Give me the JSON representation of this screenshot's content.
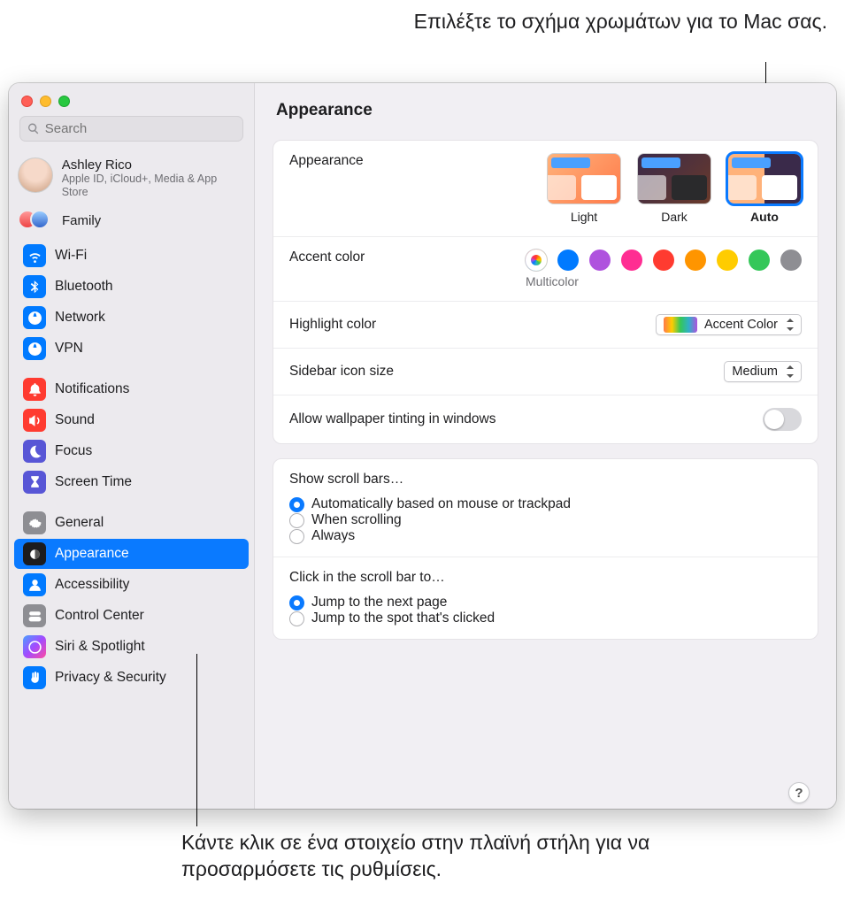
{
  "callouts": {
    "top": "Επιλέξτε το σχήμα χρωμάτων για το Mac σας.",
    "bottom": "Κάντε κλικ σε ένα στοιχείο στην πλαϊνή στήλη για να προσαρμόσετε τις ρυθμίσεις."
  },
  "window": {
    "title": "Appearance",
    "search_placeholder": "Search",
    "account": {
      "name": "Ashley Rico",
      "sub": "Apple ID, iCloud+, Media & App Store"
    },
    "family_label": "Family",
    "sidebar_groups": [
      {
        "items": [
          {
            "label": "Wi-Fi",
            "icon": "wifi",
            "cls": "ic-blue"
          },
          {
            "label": "Bluetooth",
            "icon": "bluetooth",
            "cls": "ic-blue"
          },
          {
            "label": "Network",
            "icon": "globe",
            "cls": "ic-blue"
          },
          {
            "label": "VPN",
            "icon": "globe",
            "cls": "ic-blue"
          }
        ]
      },
      {
        "items": [
          {
            "label": "Notifications",
            "icon": "bell",
            "cls": "ic-red"
          },
          {
            "label": "Sound",
            "icon": "speaker",
            "cls": "ic-red"
          },
          {
            "label": "Focus",
            "icon": "moon",
            "cls": "ic-purple"
          },
          {
            "label": "Screen Time",
            "icon": "hourglass",
            "cls": "ic-purple"
          }
        ]
      },
      {
        "items": [
          {
            "label": "General",
            "icon": "gear",
            "cls": "ic-gray"
          },
          {
            "label": "Appearance",
            "icon": "appearance",
            "cls": "ic-black",
            "selected": true
          },
          {
            "label": "Accessibility",
            "icon": "person",
            "cls": "ic-blue"
          },
          {
            "label": "Control Center",
            "icon": "switches",
            "cls": "ic-gray"
          },
          {
            "label": "Siri & Spotlight",
            "icon": "siri",
            "cls": "ic-multi"
          },
          {
            "label": "Privacy & Security",
            "icon": "hand",
            "cls": "ic-blue"
          }
        ]
      }
    ]
  },
  "settings": {
    "appearance": {
      "label": "Appearance",
      "options": [
        {
          "label": "Light",
          "cls": "thumb-light"
        },
        {
          "label": "Dark",
          "cls": "thumb-dark"
        },
        {
          "label": "Auto",
          "cls": "thumb-auto",
          "selected": true
        }
      ]
    },
    "accent": {
      "label": "Accent color",
      "caption": "Multicolor",
      "dots": [
        "dot-multi",
        "dot-blue",
        "dot-purple",
        "dot-pink",
        "dot-red",
        "dot-orange",
        "dot-yellow",
        "dot-green",
        "dot-gray"
      ]
    },
    "highlight": {
      "label": "Highlight color",
      "value": "Accent Color"
    },
    "sidebar_size": {
      "label": "Sidebar icon size",
      "value": "Medium"
    },
    "wallpaper_tint": {
      "label": "Allow wallpaper tinting in windows",
      "on": false
    },
    "scroll_show": {
      "title": "Show scroll bars…",
      "options": [
        {
          "label": "Automatically based on mouse or trackpad",
          "checked": true
        },
        {
          "label": "When scrolling",
          "checked": false
        },
        {
          "label": "Always",
          "checked": false
        }
      ]
    },
    "scroll_click": {
      "title": "Click in the scroll bar to…",
      "options": [
        {
          "label": "Jump to the next page",
          "checked": true
        },
        {
          "label": "Jump to the spot that's clicked",
          "checked": false
        }
      ]
    }
  },
  "help": "?"
}
